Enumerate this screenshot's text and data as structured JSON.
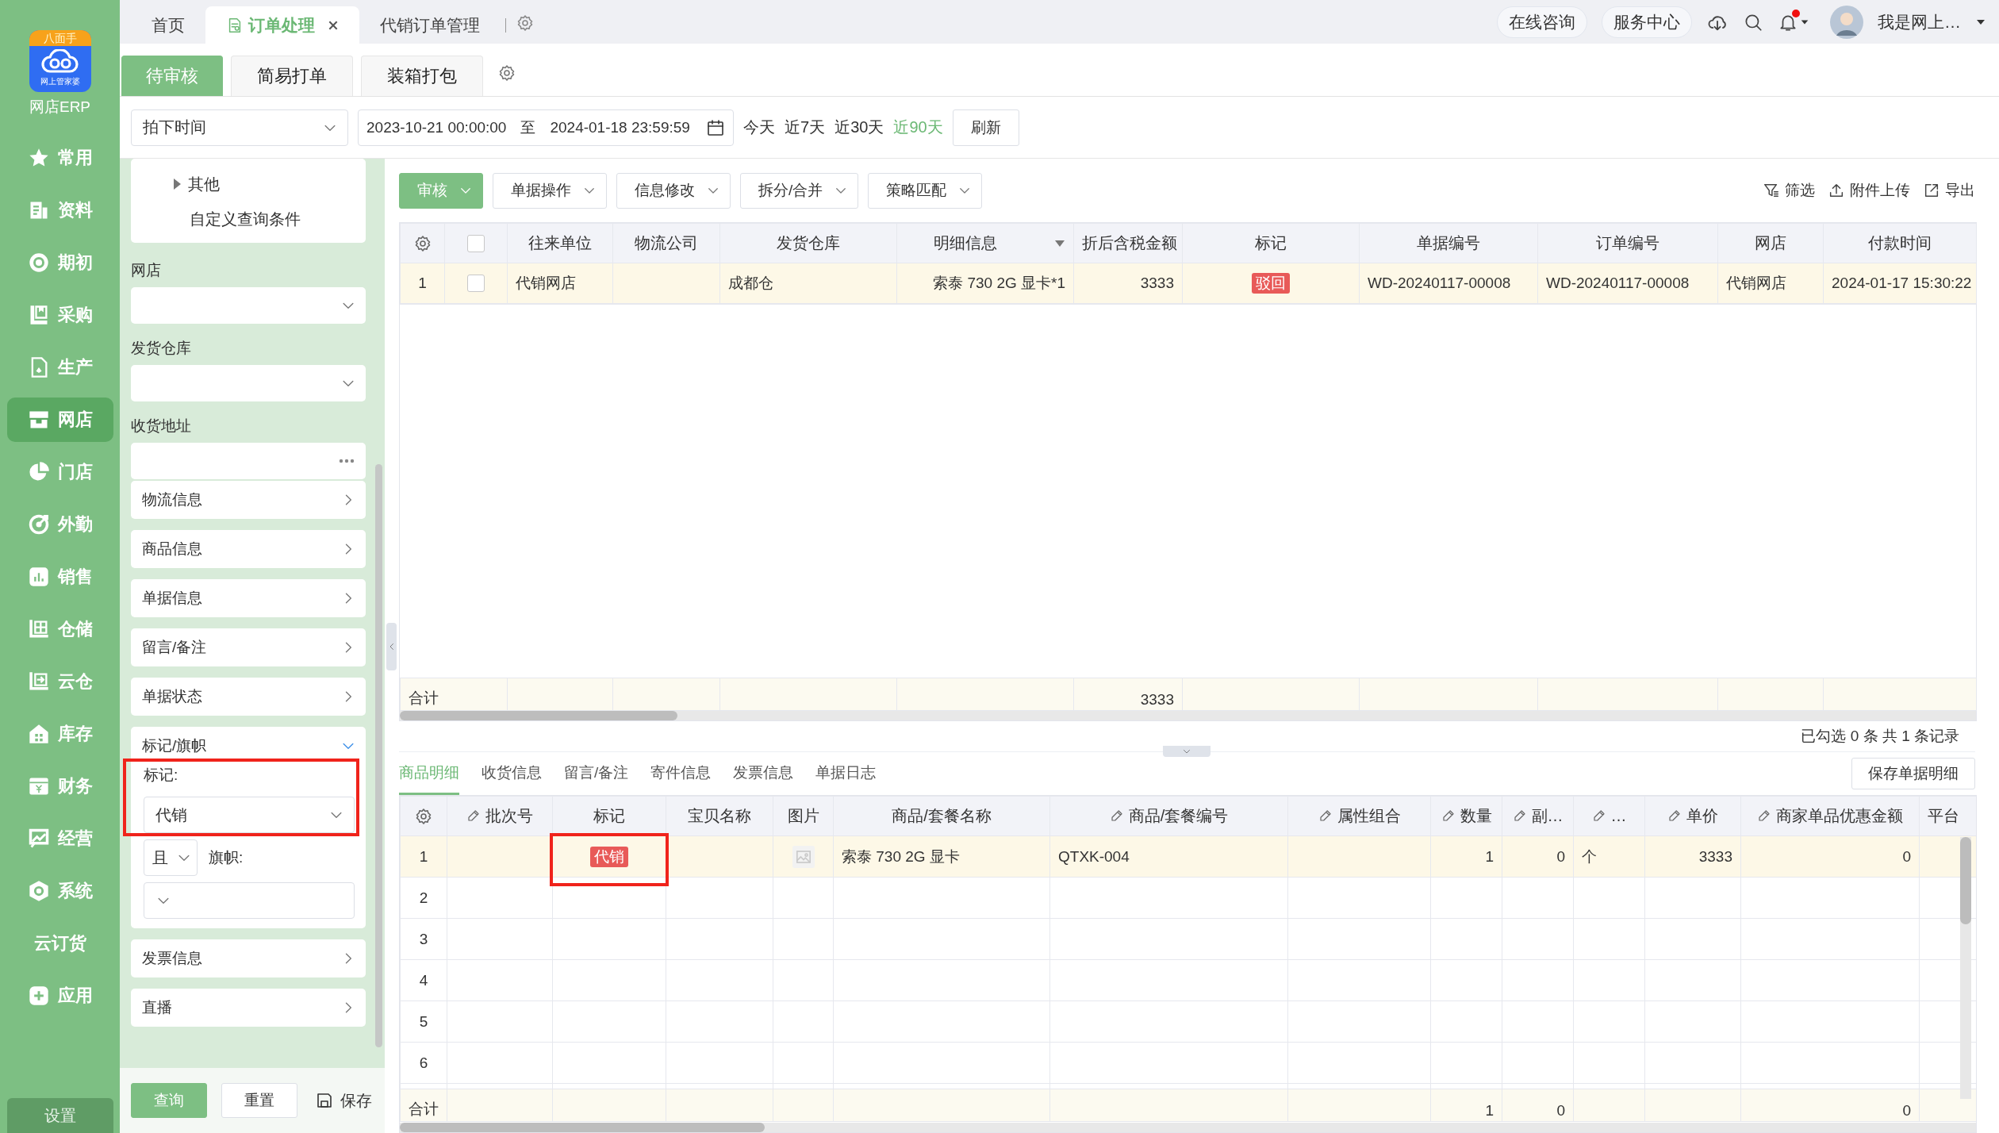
{
  "app": {
    "badge": "八面手",
    "logo_caption": "网上管家婆",
    "name": "网店ERP"
  },
  "nav": [
    {
      "label": "常用",
      "kind": "star",
      "selected": false
    },
    {
      "label": "资料",
      "kind": "doc",
      "selected": false
    },
    {
      "label": "期初",
      "kind": "disc",
      "selected": false
    },
    {
      "label": "采购",
      "kind": "clipboard",
      "selected": false
    },
    {
      "label": "生产",
      "kind": "file",
      "selected": false
    },
    {
      "label": "网店",
      "kind": "store",
      "selected": true
    },
    {
      "label": "门店",
      "kind": "pie",
      "selected": false
    },
    {
      "label": "外勤",
      "kind": "target",
      "selected": false
    },
    {
      "label": "销售",
      "kind": "bars",
      "selected": false
    },
    {
      "label": "仓储",
      "kind": "shelf",
      "selected": false
    },
    {
      "label": "云仓",
      "kind": "shelf-arrow",
      "selected": false
    },
    {
      "label": "库存",
      "kind": "house",
      "selected": false
    },
    {
      "label": "财务",
      "kind": "wallet",
      "selected": false
    },
    {
      "label": "经营",
      "kind": "trend",
      "selected": false
    },
    {
      "label": "系统",
      "kind": "hexagon",
      "selected": false
    },
    {
      "label": "云订货",
      "kind": "text",
      "selected": false
    },
    {
      "label": "应用",
      "kind": "plus",
      "selected": false
    }
  ],
  "settings": "设置",
  "tabs": [
    {
      "label": "首页",
      "selected": false,
      "closable": false
    },
    {
      "label": "订单处理",
      "selected": true,
      "closable": true
    },
    {
      "label": "代销订单管理",
      "selected": false,
      "closable": false
    }
  ],
  "header": {
    "links": [
      "在线咨询",
      "服务中心"
    ],
    "unread": true,
    "user": "我是网上…"
  },
  "subtabs": [
    {
      "label": "待审核",
      "selected": true
    },
    {
      "label": "简易打单",
      "selected": false
    },
    {
      "label": "装箱打包",
      "selected": false
    }
  ],
  "date_filter": {
    "field": "拍下时间",
    "from": "2023-10-21 00:00:00",
    "separator": "至",
    "to": "2024-01-18 23:59:59",
    "quick": [
      {
        "label": "今天",
        "selected": false
      },
      {
        "label": "近7天",
        "selected": false
      },
      {
        "label": "近30天",
        "selected": false
      },
      {
        "label": "近90天",
        "selected": true
      }
    ],
    "refresh": "刷新"
  },
  "filters": {
    "tree": [
      {
        "label": "其他",
        "kind": "group",
        "expanded": false
      },
      {
        "label": "自定义查询条件",
        "kind": "item"
      }
    ],
    "fields": [
      {
        "label": "网店",
        "kind": "select"
      },
      {
        "label": "发货仓库",
        "kind": "select"
      },
      {
        "label": "收货地址",
        "kind": "picker"
      }
    ],
    "groups": [
      {
        "label": "物流信息",
        "expanded": false
      },
      {
        "label": "商品信息",
        "expanded": false
      },
      {
        "label": "单据信息",
        "expanded": false
      },
      {
        "label": "留言/备注",
        "expanded": false
      },
      {
        "label": "单据状态",
        "expanded": false
      },
      {
        "label": "标记/旗帜",
        "expanded": true,
        "mark_label": "标记:",
        "mark_value": "代销",
        "highlighted": true,
        "joiner": "且",
        "flag_label": "旗帜:"
      },
      {
        "label": "发票信息",
        "expanded": false
      },
      {
        "label": "直播",
        "expanded": false
      }
    ],
    "query": "查询",
    "reset": "重置",
    "save": "保存"
  },
  "toolbar": {
    "buttons": [
      {
        "label": "审核",
        "primary": true
      },
      {
        "label": "单据操作",
        "primary": false
      },
      {
        "label": "信息修改",
        "primary": false
      },
      {
        "label": "拆分/合并",
        "primary": false
      },
      {
        "label": "策略匹配",
        "primary": false
      }
    ],
    "tools": [
      {
        "label": "筛选",
        "kind": "filter"
      },
      {
        "label": "附件上传",
        "kind": "upload"
      },
      {
        "label": "导出",
        "kind": "export"
      }
    ]
  },
  "orders": {
    "all_checked": false,
    "columns": [
      {
        "label": "往来单位"
      },
      {
        "label": "物流公司"
      },
      {
        "label": "发货仓库"
      },
      {
        "label": "明细信息",
        "menu": true
      },
      {
        "label": "折后含税金额",
        "total": "3333"
      },
      {
        "label": "标记"
      },
      {
        "label": "单据编号"
      },
      {
        "label": "订单编号"
      },
      {
        "label": "网店"
      },
      {
        "label": "付款时间"
      }
    ],
    "rows": [
      {
        "no": "1",
        "checked": false,
        "selected": true,
        "partner": "代销网店",
        "warehouse": "成都仓",
        "details": "索泰 730 2G  显卡*1",
        "amount": "3333",
        "mark": "驳回",
        "bill_no": "WD-20240117-00008",
        "order_no": "WD-20240117-00008",
        "shop": "代销网店",
        "paid_at": "2024-01-17 15:30:22"
      }
    ],
    "total_label": "合计"
  },
  "record_count": "已勾选 0 条  共 1 条记录",
  "detail_tabs": [
    {
      "label": "商品明细",
      "selected": true
    },
    {
      "label": "收货信息",
      "selected": false
    },
    {
      "label": "留言/备注",
      "selected": false
    },
    {
      "label": "寄件信息",
      "selected": false
    },
    {
      "label": "发票信息",
      "selected": false
    },
    {
      "label": "单据日志",
      "selected": false
    }
  ],
  "save_detail": "保存单据明细",
  "items": {
    "columns": [
      {
        "label": "批次号",
        "editable": true
      },
      {
        "label": "标记",
        "editable": false
      },
      {
        "label": "宝贝名称",
        "editable": false
      },
      {
        "label": "图片",
        "editable": false
      },
      {
        "label": "商品/套餐名称",
        "editable": false
      },
      {
        "label": "商品/套餐编号",
        "editable": true
      },
      {
        "label": "属性组合",
        "editable": true
      },
      {
        "label": "数量",
        "editable": true,
        "total": "1"
      },
      {
        "label": "副…",
        "editable": true,
        "total": "0"
      },
      {
        "label": "…",
        "editable": true
      },
      {
        "label": "单价",
        "editable": true
      },
      {
        "label": "商家单品优惠金额",
        "editable": true,
        "total": "0"
      },
      {
        "label": "平台",
        "editable": false
      }
    ],
    "rows": [
      {
        "no": "1",
        "selected": true,
        "image": true,
        "highlighted": true,
        "mark": "代销",
        "product_name": "索泰 730 2G 显卡",
        "product_code": "QTXK-004",
        "qty": "1",
        "sub_qty": "0",
        "unit": "个",
        "price": "3333",
        "discount": "0"
      },
      {
        "no": "2",
        "selected": false
      },
      {
        "no": "3",
        "selected": false
      },
      {
        "no": "4",
        "selected": false
      },
      {
        "no": "5",
        "selected": false
      },
      {
        "no": "6",
        "selected": false
      }
    ],
    "total_label": "合计"
  }
}
